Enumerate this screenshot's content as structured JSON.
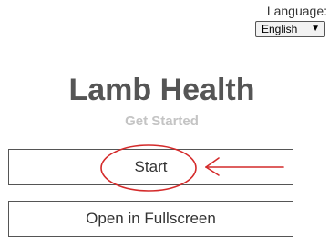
{
  "language": {
    "label": "Language:",
    "selected": "English"
  },
  "app": {
    "title": "Lamb Health",
    "subtitle": "Get Started"
  },
  "buttons": {
    "start": "Start",
    "fullscreen": "Open in Fullscreen"
  },
  "annotation": {
    "color": "#d42a2a"
  }
}
